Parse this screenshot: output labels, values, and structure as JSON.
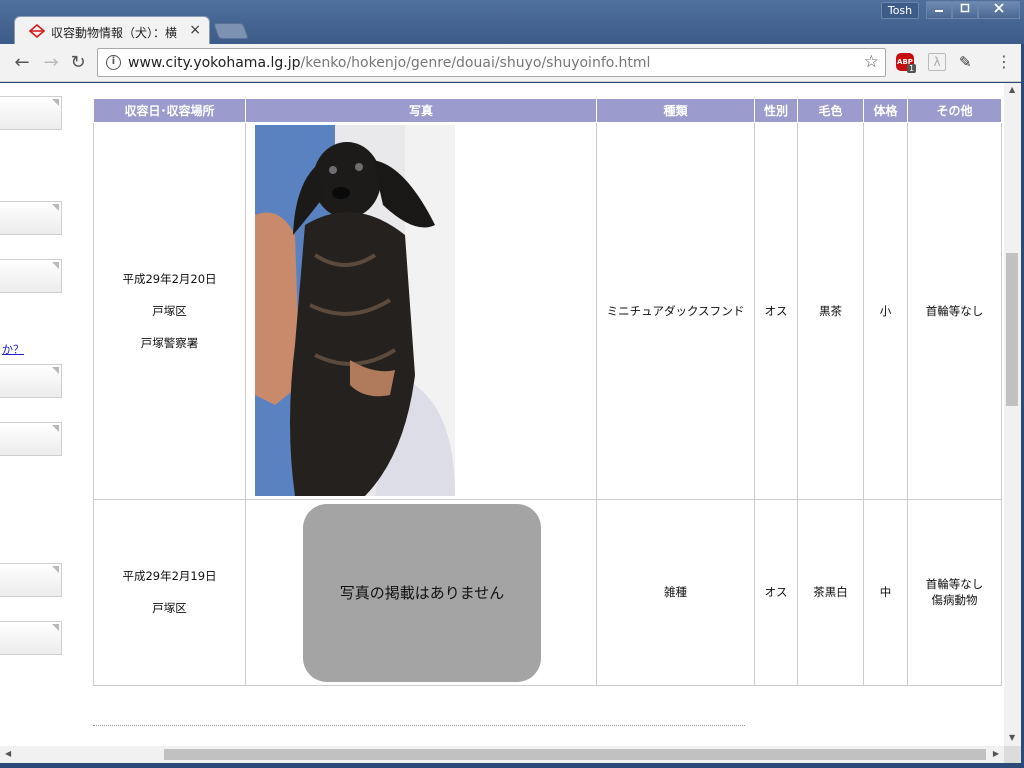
{
  "browser": {
    "tab_title": "収容動物情報（犬）：横",
    "tab_close": "×",
    "user": "Tosh",
    "url_host": "www.city.yokohama.lg.jp",
    "url_path": "/kenko/hokenjo/genre/douai/shuyo/shuyoinfo.html",
    "abp_label": "ABP",
    "abp_badge": "1"
  },
  "sidebar": {
    "link_text": "か？"
  },
  "table": {
    "headers": [
      "収容日･収容場所",
      "写真",
      "種類",
      "性別",
      "毛色",
      "体格",
      "その他"
    ],
    "rows": [
      {
        "date": "平成29年2月20日",
        "district": "戸塚区",
        "place": "戸塚警察署",
        "breed": "ミニチュアダックスフンド",
        "sex": "オス",
        "color": "黒茶",
        "size": "小",
        "other": "首輪等なし"
      },
      {
        "date": "平成29年2月19日",
        "district": "戸塚区",
        "no_photo": "写真の掲載はありません",
        "breed": "雑種",
        "sex": "オス",
        "color": "茶黒白",
        "size": "中",
        "other_1": "首輪等なし",
        "other_2": "傷病動物"
      }
    ]
  },
  "colors": {
    "header_bg": "#9b9bce",
    "placeholder_bg": "#a4a4a4",
    "frame": "#2b4a78"
  }
}
